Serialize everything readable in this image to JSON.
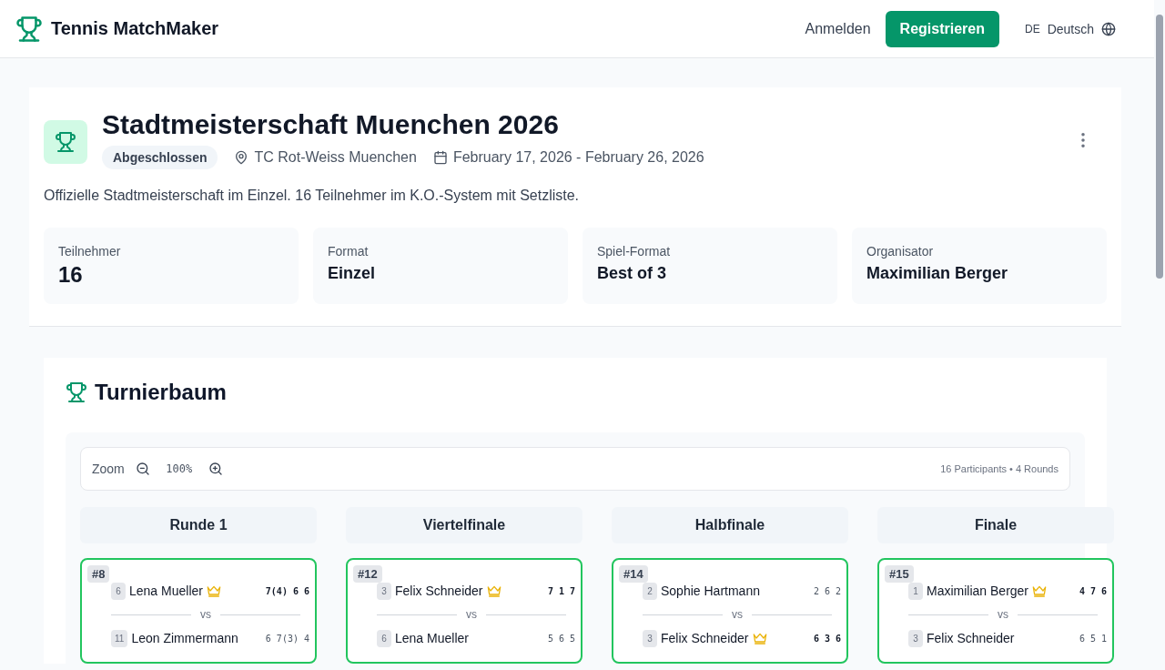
{
  "header": {
    "brand": "Tennis MatchMaker",
    "login": "Anmelden",
    "register": "Registrieren",
    "language_code": "DE",
    "language": "Deutsch"
  },
  "tournament": {
    "title": "Stadtmeisterschaft Muenchen 2026",
    "status": "Abgeschlossen",
    "venue": "TC Rot-Weiss Muenchen",
    "dates": "February 17, 2026 - February 26, 2026",
    "description": "Offizielle Stadtmeisterschaft im Einzel. 16 Teilnehmer im K.O.-System mit Setzliste.",
    "stats": [
      {
        "label": "Teilnehmer",
        "value": "16",
        "kind": "number"
      },
      {
        "label": "Format",
        "value": "Einzel",
        "kind": "text"
      },
      {
        "label": "Spiel-Format",
        "value": "Best of 3",
        "kind": "text"
      },
      {
        "label": "Organisator",
        "value": "Maximilian Berger",
        "kind": "text"
      }
    ]
  },
  "bracket": {
    "title": "Turnierbaum",
    "zoom_label": "Zoom",
    "zoom_value": "100%",
    "summary": "16 Participants • 4 Rounds",
    "rounds": [
      {
        "title": "Runde 1",
        "matches": [
          {
            "id": "#8",
            "vs": "vs",
            "players": [
              {
                "seed": "6",
                "name": "Lena Mueller",
                "winner": true,
                "scores": "7(4) 6 6"
              },
              {
                "seed": "11",
                "name": "Leon Zimmermann",
                "winner": false,
                "scores": "6 7(3) 4"
              }
            ]
          }
        ]
      },
      {
        "title": "Viertelfinale",
        "matches": [
          {
            "id": "#12",
            "vs": "vs",
            "players": [
              {
                "seed": "3",
                "name": "Felix Schneider",
                "winner": true,
                "scores": "7 1 7"
              },
              {
                "seed": "6",
                "name": "Lena Mueller",
                "winner": false,
                "scores": "5 6 5"
              }
            ]
          }
        ]
      },
      {
        "title": "Halbfinale",
        "matches": [
          {
            "id": "#14",
            "vs": "vs",
            "players": [
              {
                "seed": "2",
                "name": "Sophie Hartmann",
                "winner": false,
                "scores": "2 6 2"
              },
              {
                "seed": "3",
                "name": "Felix Schneider",
                "winner": true,
                "scores": "6 3 6"
              }
            ]
          }
        ]
      },
      {
        "title": "Finale",
        "matches": [
          {
            "id": "#15",
            "vs": "vs",
            "players": [
              {
                "seed": "1",
                "name": "Maximilian Berger",
                "winner": true,
                "scores": "4 7 6"
              },
              {
                "seed": "3",
                "name": "Felix Schneider",
                "winner": false,
                "scores": "6 5 1"
              }
            ]
          }
        ]
      }
    ]
  }
}
